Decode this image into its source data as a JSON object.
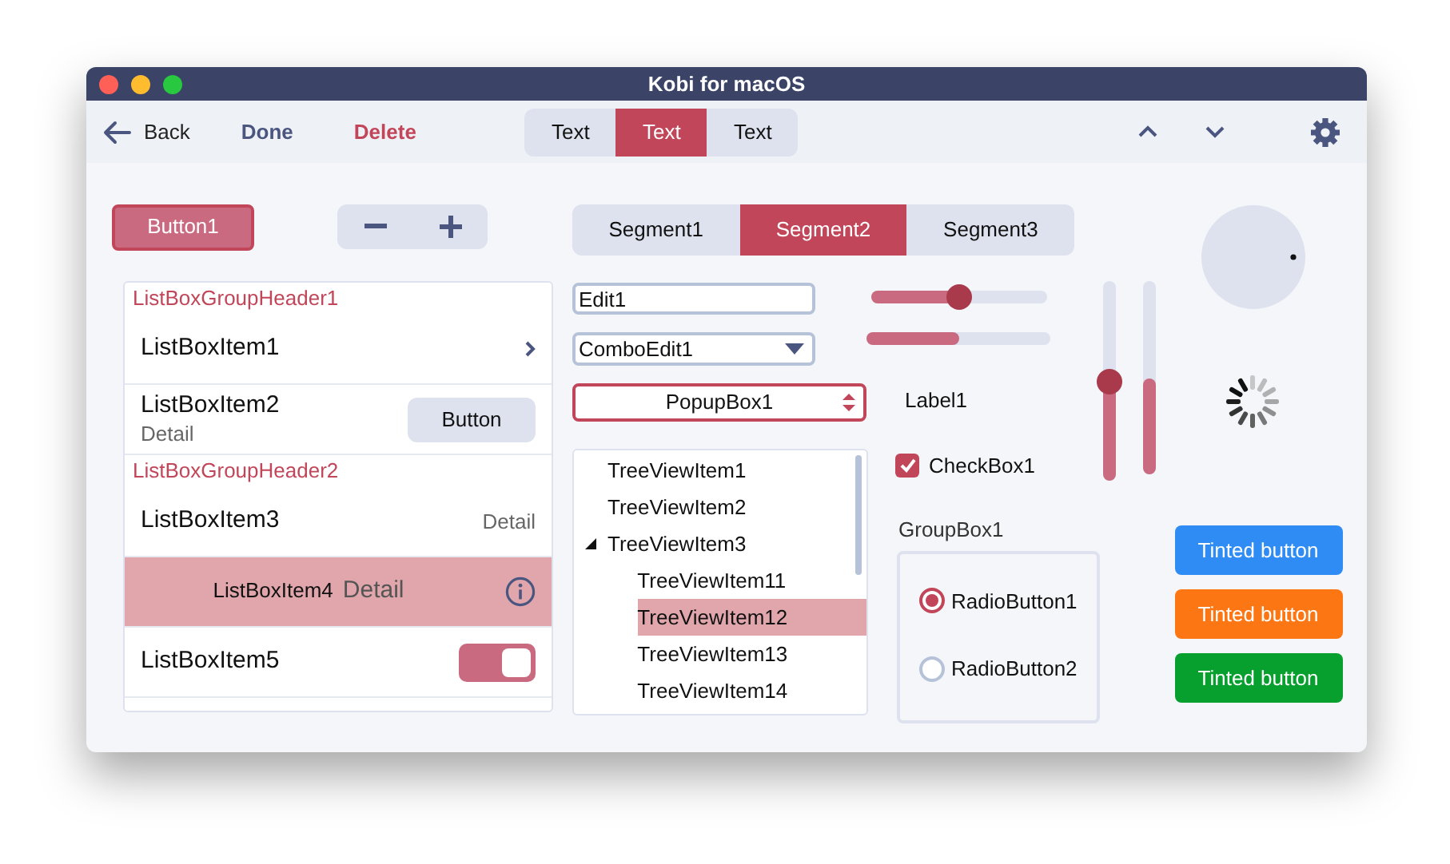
{
  "window": {
    "title": "Kobi for macOS"
  },
  "toolbar": {
    "back": "Back",
    "done": "Done",
    "delete": "Delete",
    "tabs": [
      {
        "label": "Text",
        "selected": false
      },
      {
        "label": "Text",
        "selected": true
      },
      {
        "label": "Text",
        "selected": false
      }
    ]
  },
  "button1": "Button1",
  "segments": [
    {
      "label": "Segment1",
      "selected": false
    },
    {
      "label": "Segment2",
      "selected": true
    },
    {
      "label": "Segment3",
      "selected": false
    }
  ],
  "list_box": [
    {
      "kind": "header",
      "title": "ListBoxGroupHeader1"
    },
    {
      "kind": "chevron",
      "title": "ListBoxItem1",
      "selected": false
    },
    {
      "kind": "button",
      "title": "ListBoxItem2",
      "detail": "Detail",
      "button": "Button",
      "selected": false
    },
    {
      "kind": "header",
      "title": "ListBoxGroupHeader2"
    },
    {
      "kind": "detail",
      "title": "ListBoxItem3",
      "detail": "Detail",
      "selected": false
    },
    {
      "kind": "info",
      "title": "ListBoxItem4",
      "detail": "Detail",
      "selected": true
    },
    {
      "kind": "switch",
      "title": "ListBoxItem5",
      "on": true,
      "selected": false
    }
  ],
  "edit": {
    "value": "Edit1"
  },
  "combo_edit": {
    "value": "ComboEdit1"
  },
  "popup_box": {
    "value": "PopupBox1"
  },
  "tree": [
    {
      "label": "TreeViewItem1",
      "selected": false
    },
    {
      "label": "TreeViewItem2",
      "selected": false
    },
    {
      "label": "TreeViewItem3",
      "selected": false,
      "expanded": true,
      "children": [
        {
          "label": "TreeViewItem11",
          "selected": false
        },
        {
          "label": "TreeViewItem12",
          "selected": true
        },
        {
          "label": "TreeViewItem13",
          "selected": false
        },
        {
          "label": "TreeViewItem14",
          "selected": false
        }
      ]
    }
  ],
  "slider": {
    "level": 0.5
  },
  "progress": {
    "level": 0.5
  },
  "label": "Label1",
  "checkbox": {
    "label": "CheckBox1",
    "checked": true
  },
  "group_box": {
    "title": "GroupBox1",
    "radios": [
      {
        "label": "RadioButton1",
        "selected": true
      },
      {
        "label": "RadioButton2",
        "selected": false
      }
    ]
  },
  "vertical_slider": {
    "level": 0.5
  },
  "vertical_progress": {
    "level": 0.5
  },
  "tinted_buttons": [
    {
      "label": "Tinted button",
      "color": "#2f8cf5"
    },
    {
      "label": "Tinted button",
      "color": "#fd7614"
    },
    {
      "label": "Tinted button",
      "color": "#07a02f"
    }
  ]
}
